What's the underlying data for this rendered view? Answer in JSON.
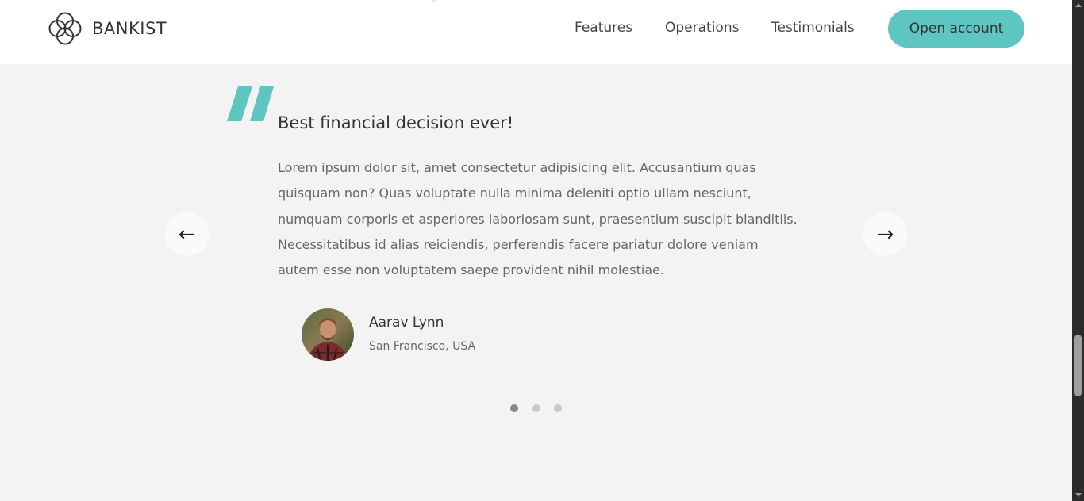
{
  "nav": {
    "logo_text": "BANKIST",
    "links": [
      "Features",
      "Operations",
      "Testimonials"
    ],
    "cta_label": "Open account"
  },
  "testimonial": {
    "title": "Best financial decision ever!",
    "text": "Lorem ipsum dolor sit, amet consectetur adipisicing elit. Accusantium quas quisquam non? Quas voluptate nulla minima deleniti optio ullam nesciunt, numquam corporis et asperiores laboriosam sunt, praesentium suscipit blanditiis. Necessitatibus id alias reiciendis, perferendis facere pariatur dolore veniam autem esse non voluptatem saepe provident nihil molestiae.",
    "author_name": "Aarav Lynn",
    "author_location": "San Francisco, USA"
  },
  "slider": {
    "prev_icon": "←",
    "next_icon": "→",
    "dot_count": 3,
    "active_dot": 0
  },
  "colors": {
    "accent": "#5ec5c0",
    "background": "#f3f3f3",
    "nav_background": "#ffffff"
  },
  "icons": {
    "logo": "four-circles-logo-icon",
    "quote": "quote-mark-icon",
    "prev": "arrow-left-icon",
    "next": "arrow-right-icon"
  }
}
